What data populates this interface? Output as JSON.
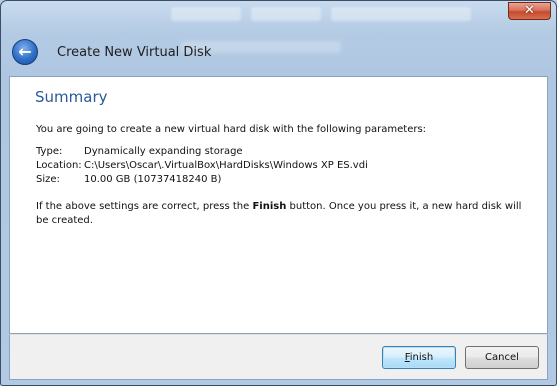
{
  "window": {
    "title": "Create New Virtual Disk",
    "close_label": "x"
  },
  "summary": {
    "heading": "Summary",
    "intro": "You are going to create a new virtual hard disk with the following parameters:",
    "params": [
      {
        "label": "Type:",
        "value": "Dynamically expanding storage"
      },
      {
        "label": "Location:",
        "value": "C:\\Users\\Oscar\\.VirtualBox\\HardDisks\\Windows XP ES.vdi"
      },
      {
        "label": "Size:",
        "value": "10.00 GB (10737418240 B)"
      }
    ],
    "note_before": "If the above settings are correct, press the ",
    "note_bold": "Finish",
    "note_after": " button. Once you press it, a new hard disk will be created."
  },
  "buttons": {
    "finish_first": "F",
    "finish_rest": "inish",
    "cancel": "Cancel"
  }
}
